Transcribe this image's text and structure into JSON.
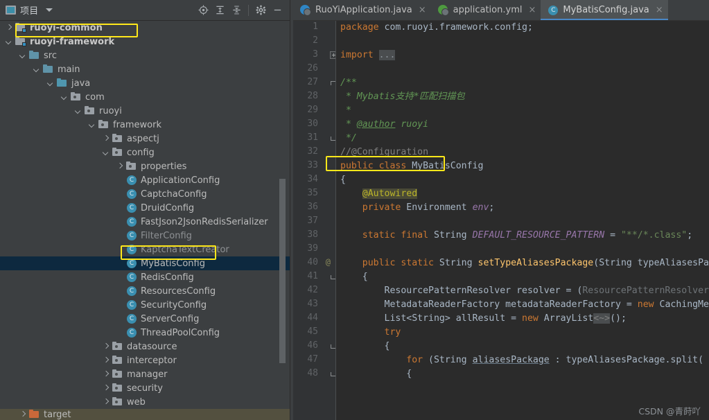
{
  "project_panel": {
    "title": "项目",
    "icons": {
      "project_icon": "project-window-icon",
      "caret": "chevron-down-icon",
      "locate": "locate-target-icon",
      "expand_all": "expand-all-icon",
      "collapse_all": "collapse-all-icon",
      "settings": "gear-icon",
      "minimize": "minimize-icon"
    },
    "tree": [
      {
        "label": "ruoyi-common",
        "indent": 1,
        "arrow": "right",
        "icon": "module",
        "bold": true,
        "selected": false
      },
      {
        "label": "ruoyi-framework",
        "indent": 1,
        "arrow": "down",
        "icon": "module",
        "bold": true,
        "selected": false,
        "highlight": true
      },
      {
        "label": "src",
        "indent": 2,
        "arrow": "down",
        "icon": "folder-blue",
        "bold": false,
        "selected": false
      },
      {
        "label": "main",
        "indent": 3,
        "arrow": "down",
        "icon": "folder-blue",
        "bold": false,
        "selected": false
      },
      {
        "label": "java",
        "indent": 4,
        "arrow": "down",
        "icon": "folder-teal",
        "bold": false,
        "selected": false
      },
      {
        "label": "com",
        "indent": 5,
        "arrow": "down",
        "icon": "package",
        "bold": false,
        "selected": false
      },
      {
        "label": "ruoyi",
        "indent": 6,
        "arrow": "down",
        "icon": "package",
        "bold": false,
        "selected": false
      },
      {
        "label": "framework",
        "indent": 7,
        "arrow": "down",
        "icon": "package",
        "bold": false,
        "selected": false
      },
      {
        "label": "aspectj",
        "indent": 8,
        "arrow": "right",
        "icon": "package",
        "bold": false,
        "selected": false
      },
      {
        "label": "config",
        "indent": 8,
        "arrow": "down",
        "icon": "package",
        "bold": false,
        "selected": false
      },
      {
        "label": "properties",
        "indent": 9,
        "arrow": "right",
        "icon": "package",
        "bold": false,
        "selected": false
      },
      {
        "label": "ApplicationConfig",
        "indent": 9,
        "arrow": "none",
        "icon": "class",
        "bold": false,
        "selected": false
      },
      {
        "label": "CaptchaConfig",
        "indent": 9,
        "arrow": "none",
        "icon": "class",
        "bold": false,
        "selected": false
      },
      {
        "label": "DruidConfig",
        "indent": 9,
        "arrow": "none",
        "icon": "class",
        "bold": false,
        "selected": false
      },
      {
        "label": "FastJson2JsonRedisSerializer",
        "indent": 9,
        "arrow": "none",
        "icon": "class",
        "bold": false,
        "selected": false
      },
      {
        "label": "FilterConfig",
        "indent": 9,
        "arrow": "none",
        "icon": "class",
        "bold": false,
        "selected": false,
        "dim": true
      },
      {
        "label": "KaptchaTextCreator",
        "indent": 9,
        "arrow": "none",
        "icon": "class",
        "bold": false,
        "selected": false,
        "dim": true
      },
      {
        "label": "MyBatisConfig",
        "indent": 9,
        "arrow": "none",
        "icon": "class",
        "bold": false,
        "selected": true,
        "highlight": true
      },
      {
        "label": "RedisConfig",
        "indent": 9,
        "arrow": "none",
        "icon": "class",
        "bold": false,
        "selected": false
      },
      {
        "label": "ResourcesConfig",
        "indent": 9,
        "arrow": "none",
        "icon": "class",
        "bold": false,
        "selected": false
      },
      {
        "label": "SecurityConfig",
        "indent": 9,
        "arrow": "none",
        "icon": "class",
        "bold": false,
        "selected": false
      },
      {
        "label": "ServerConfig",
        "indent": 9,
        "arrow": "none",
        "icon": "class",
        "bold": false,
        "selected": false
      },
      {
        "label": "ThreadPoolConfig",
        "indent": 9,
        "arrow": "none",
        "icon": "class",
        "bold": false,
        "selected": false
      },
      {
        "label": "datasource",
        "indent": 8,
        "arrow": "right",
        "icon": "package",
        "bold": false,
        "selected": false
      },
      {
        "label": "interceptor",
        "indent": 8,
        "arrow": "right",
        "icon": "package",
        "bold": false,
        "selected": false
      },
      {
        "label": "manager",
        "indent": 8,
        "arrow": "right",
        "icon": "package",
        "bold": false,
        "selected": false
      },
      {
        "label": "security",
        "indent": 8,
        "arrow": "right",
        "icon": "package",
        "bold": false,
        "selected": false
      },
      {
        "label": "web",
        "indent": 8,
        "arrow": "right",
        "icon": "package",
        "bold": false,
        "selected": false
      }
    ],
    "tree_bottom": [
      {
        "label": "target",
        "indent": 2,
        "arrow": "right",
        "icon": "folder-orange",
        "bold": false,
        "selected": false
      }
    ]
  },
  "editor": {
    "tabs": [
      {
        "label": "RuoYiApplication.java",
        "icon": "spring-boot-class-icon",
        "active": false,
        "close": "×"
      },
      {
        "label": "application.yml",
        "icon": "spring-yaml-icon",
        "active": false,
        "close": "×"
      },
      {
        "label": "MyBatisConfig.java",
        "icon": "java-class-icon",
        "active": true,
        "close": "×"
      }
    ],
    "lines": [
      {
        "num": "1",
        "at": "",
        "fold": "",
        "html": "<span class=\"kw\">package</span> com.ruoyi.framework.config;"
      },
      {
        "num": "2",
        "at": "",
        "fold": "",
        "html": ""
      },
      {
        "num": "3",
        "at": "",
        "fold": "plus",
        "html": "<span class=\"kw\">import</span> <span class=\"imp-dots\">...</span>"
      },
      {
        "num": "26",
        "at": "",
        "fold": "",
        "html": ""
      },
      {
        "num": "27",
        "at": "",
        "fold": "top",
        "html": "<span class=\"cmt\">/**</span>"
      },
      {
        "num": "28",
        "at": "",
        "fold": "",
        "html": " <span class=\"cmt\">* Mybatis支持*匹配扫描包</span>"
      },
      {
        "num": "29",
        "at": "",
        "fold": "",
        "html": " <span class=\"cmt\">*</span>"
      },
      {
        "num": "30",
        "at": "",
        "fold": "",
        "html": " <span class=\"cmt\">* <span class=\"underl\">@author</span> ruoyi</span>"
      },
      {
        "num": "31",
        "at": "",
        "fold": "bot",
        "html": " <span class=\"cmt\">*/</span>"
      },
      {
        "num": "32",
        "at": "",
        "fold": "",
        "html": "<span class=\"cmt2\">//@Configuration</span>"
      },
      {
        "num": "33",
        "at": "",
        "fold": "",
        "html": "<span class=\"kw\">public class </span><span class=\"typ\">MyBatisConfig</span>"
      },
      {
        "num": "34",
        "at": "",
        "fold": "",
        "html": "{"
      },
      {
        "num": "35",
        "at": "",
        "fold": "",
        "html": "    <span class=\"annohl\">@Autowired</span>"
      },
      {
        "num": "36",
        "at": "",
        "fold": "",
        "html": "    <span class=\"kw\">private</span> Environment <span class=\"fld2\">env</span>;"
      },
      {
        "num": "37",
        "at": "",
        "fold": "",
        "html": ""
      },
      {
        "num": "38",
        "at": "",
        "fold": "",
        "html": "    <span class=\"kw\">static final</span> String <span class=\"fld2\">DEFAULT_RESOURCE_PATTERN</span> = <span class=\"str\">\"**/*.class\"</span>;"
      },
      {
        "num": "39",
        "at": "",
        "fold": "",
        "html": ""
      },
      {
        "num": "40",
        "at": "@",
        "fold": "",
        "html": "    <span class=\"kw\">public static</span> String <span class=\"mth\">setTypeAliasesPackage</span>(String typeAliasesPa"
      },
      {
        "num": "41",
        "at": "",
        "fold": "bot2",
        "html": "    {"
      },
      {
        "num": "42",
        "at": "",
        "fold": "",
        "html": "        ResourcePatternResolver resolver = (<span class=\"grey\">ResourcePatternResolver</span>"
      },
      {
        "num": "43",
        "at": "",
        "fold": "",
        "html": "        MetadataReaderFactory metadataReaderFactory = <span class=\"kw\">new</span> CachingMe"
      },
      {
        "num": "44",
        "at": "",
        "fold": "",
        "html": "        List&lt;String&gt; allResult = <span class=\"kw\">new</span> ArrayList<span class=\"gen-hl\">&lt;~&gt;</span>();"
      },
      {
        "num": "45",
        "at": "",
        "fold": "",
        "html": "        <span class=\"kw\">try</span>"
      },
      {
        "num": "46",
        "at": "",
        "fold": "bot2",
        "html": "        {"
      },
      {
        "num": "47",
        "at": "",
        "fold": "",
        "html": "            <span class=\"kw\">for</span> (String <span class=\"uline\">aliasesPackage</span> : typeAliasesPackage.split("
      },
      {
        "num": "48",
        "at": "",
        "fold": "bot2",
        "html": "            {"
      }
    ],
    "watermark": "CSDN @青莳吖"
  },
  "colors": {
    "panel_bg": "#3c3f41",
    "editor_bg": "#2b2b2b",
    "gutter_bg": "#313335",
    "selection": "#0d293f",
    "highlight_border": "#ffe81a",
    "tab_active_underline": "#4a88c7",
    "class_icon": "#3a8fb0"
  }
}
